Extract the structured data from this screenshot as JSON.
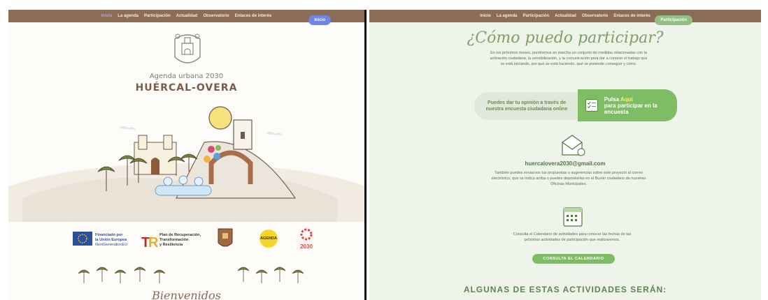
{
  "left": {
    "nav": [
      "Inicio",
      "La agenda",
      "Participación",
      "Actualidad",
      "Observatorio",
      "Enlaces de interés"
    ],
    "pill": "Inicio",
    "subtitle": "Agenda urbana 2030",
    "title": "HUÉRCAL-OVERA",
    "logos": {
      "eu_line1": "Financiado por",
      "eu_line2": "la Unión Europea",
      "eu_line3": "NextGenerationEU",
      "prtr_line1": "Plan de Recuperación,",
      "prtr_line2": "Transformación",
      "prtr_line3": "y Resiliencia",
      "agenda_label": "AGENDA",
      "ods_year": "2030"
    },
    "welcome": "Bienvenidos"
  },
  "right": {
    "nav": [
      "Inicio",
      "La agenda",
      "Participación",
      "Actualidad",
      "Observatorio",
      "Enlaces de interés"
    ],
    "pill": "Participación",
    "title": "¿Cómo puedo participar?",
    "intro": "En los próximos meses, pondremos en marcha un conjunto de medidas relacionadas con la activación ciudadana, la sensibilización, y la comunicación para dar a conocer el trabajo que se está iniciando, por qué se está haciendo, qué se pretende conseguir y cómo.",
    "card_left": "Puedes dar tu opinión a través de nuestra encuesta ciudadana online",
    "card_right_a": "Pulsa",
    "card_right_aqui": "Aquí",
    "card_right_b": "para participar en la encuesta",
    "email": "huercalovera2030@gmail.com",
    "text2": "También puedes enviarnos tus propuestas o sugerencias sobre este proyecto al correo electrónico, que se indica arriba o puedes depositarlas en el Buzón ciudadano de nuestras Oficinas Municipales.",
    "text3": "Consulta el Calendario de actividades para conocer las fechas de las próximas actividades de participación que realizaremos.",
    "cal_button": "CONSULTA EL CALENDARIO",
    "heading": "ALGUNAS DE ESTAS ACTIVIDADES SERÁN:"
  },
  "colors": {
    "nav_bg": "#8c6b57",
    "brand_brown": "#7c5b48",
    "green": "#7fbd65",
    "blue_pill": "#6f86e6",
    "right_bg": "#eef4ea"
  }
}
